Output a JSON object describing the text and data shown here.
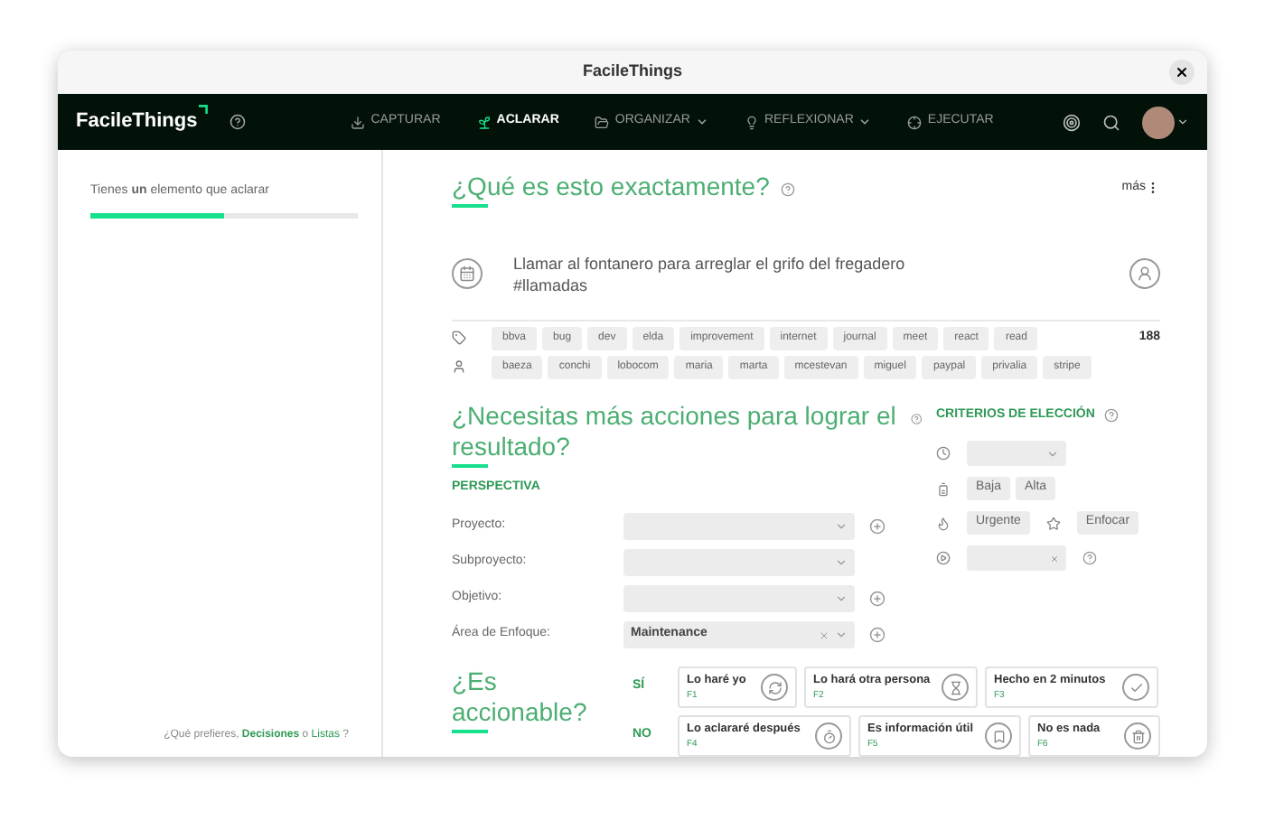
{
  "window": {
    "title": "FacileThings"
  },
  "navbar": {
    "logo": "FacileThings",
    "items": [
      {
        "label": "CAPTURAR",
        "kind": "capture",
        "selected": false,
        "dropdown": false
      },
      {
        "label": "ACLARAR",
        "kind": "clarify",
        "selected": true,
        "dropdown": false
      },
      {
        "label": "ORGANIZAR",
        "kind": "organize",
        "selected": false,
        "dropdown": true
      },
      {
        "label": "REFLEXIONAR",
        "kind": "reflect",
        "selected": false,
        "dropdown": true
      },
      {
        "label": "EJECUTAR",
        "kind": "engage",
        "selected": false,
        "dropdown": false
      }
    ]
  },
  "sidebar": {
    "message": "Tienes **un** elemento que aclarar",
    "progress": {
      "level": 0.5
    },
    "footer": {
      "question": "¿Qué prefieres,",
      "link_1": "Decisiones",
      "joiner": "o",
      "link_2": "Listas",
      "end": "?"
    }
  },
  "clarify": {
    "title": "¿Qué es esto exactamente?",
    "more": "más",
    "item": {
      "text": "Llamar al fontanero para arreglar el grifo del fregadero",
      "hashtag": "#llamadas"
    },
    "tags": [
      "bbva",
      "bug",
      "dev",
      "elda",
      "improvement",
      "internet",
      "journal",
      "meet",
      "react",
      "read"
    ],
    "contacts": [
      "baeza",
      "conchi",
      "lobocom",
      "maria",
      "marta",
      "mcestevan",
      "miguel",
      "paypal",
      "privalia",
      "stripe"
    ],
    "count": "188"
  },
  "actions_needed": {
    "title": "¿Necesitas más acciones para lograr el resultado?",
    "perspective": {
      "title": "PERSPECTIVA",
      "fields": [
        {
          "label": "Proyecto:",
          "add": true
        },
        {
          "label": "Subproyecto:",
          "add": false
        },
        {
          "label": "Objetivo:",
          "add": true
        },
        {
          "label": "Área de Enfoque:",
          "value": "Maintenance",
          "add": true
        }
      ]
    },
    "criteria": {
      "title": "CRITERIOS DE ELECCIÓN",
      "energy": [
        "Baja",
        "Alta"
      ],
      "urgent": "Urgente",
      "focus": "Enfocar"
    }
  },
  "actionable": {
    "title": "¿Es accionable?",
    "rows": [
      {
        "label": "SÍ",
        "options": [
          {
            "label": "Lo haré yo",
            "key": "F1",
            "kind": "do"
          },
          {
            "label": "Lo hará otra persona",
            "key": "F2",
            "kind": "delegate"
          },
          {
            "label": "Hecho en 2 minutos",
            "key": "F3",
            "kind": "done"
          }
        ]
      },
      {
        "label": "NO",
        "options": [
          {
            "label": "Lo aclararé después",
            "key": "F4",
            "kind": "defer"
          },
          {
            "label": "Es información útil",
            "key": "F5",
            "kind": "reference"
          },
          {
            "label": "No es nada",
            "key": "F6",
            "kind": "trash"
          }
        ]
      }
    ]
  }
}
